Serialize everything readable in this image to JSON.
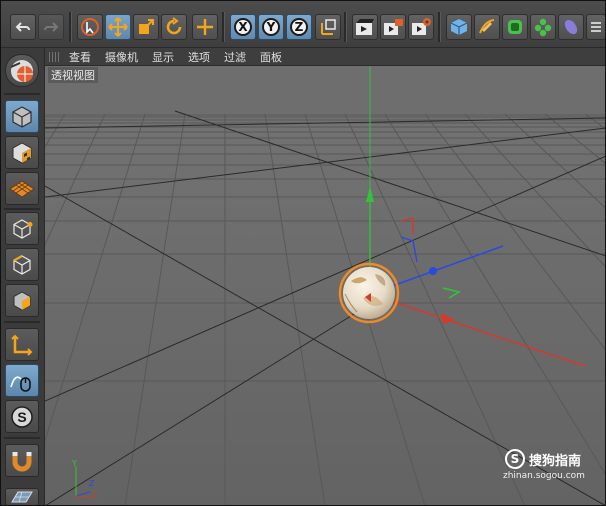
{
  "toolbar": {
    "undo_icon": "undo-icon",
    "redo_icon": "redo-icon",
    "tools": [
      "live-selection-icon",
      "move-icon",
      "scale-icon",
      "rotate-icon",
      "recent-tool-icon"
    ],
    "axis_locks": [
      "X",
      "Y",
      "Z"
    ],
    "coordinate_icon": "world-coordinate-icon",
    "render_icons": [
      "render-view-icon",
      "render-to-picture-viewer-icon",
      "render-settings-icon"
    ],
    "object_icons": [
      "cube-icon",
      "pen-spline-icon",
      "subdivision-icon",
      "cloner-icon",
      "deformer-icon"
    ]
  },
  "left_tools": [
    "model-mode-icon",
    "object-mode-icon",
    "texture-mode-icon",
    "workplane-icon",
    "points-mode-icon",
    "edges-mode-icon",
    "polygons-mode-icon",
    "axis-mode-icon",
    "tweak-mode-icon",
    "solo-icon",
    "snap-icon",
    "workplane-grid-icon"
  ],
  "viewport": {
    "menu": [
      "查看",
      "摄像机",
      "显示",
      "选项",
      "过滤",
      "面板"
    ],
    "label": "透视视图"
  },
  "watermark": {
    "logo": "S",
    "text": "搜狗指南",
    "url": "zhinan.sogou.com"
  },
  "colors": {
    "viewport_bg": "#6b6b6b",
    "axis_x": "#d23a2e",
    "axis_y": "#33c23a",
    "axis_z": "#2b49e0",
    "selection": "#f08a24",
    "active_button": "#6a94ba"
  }
}
